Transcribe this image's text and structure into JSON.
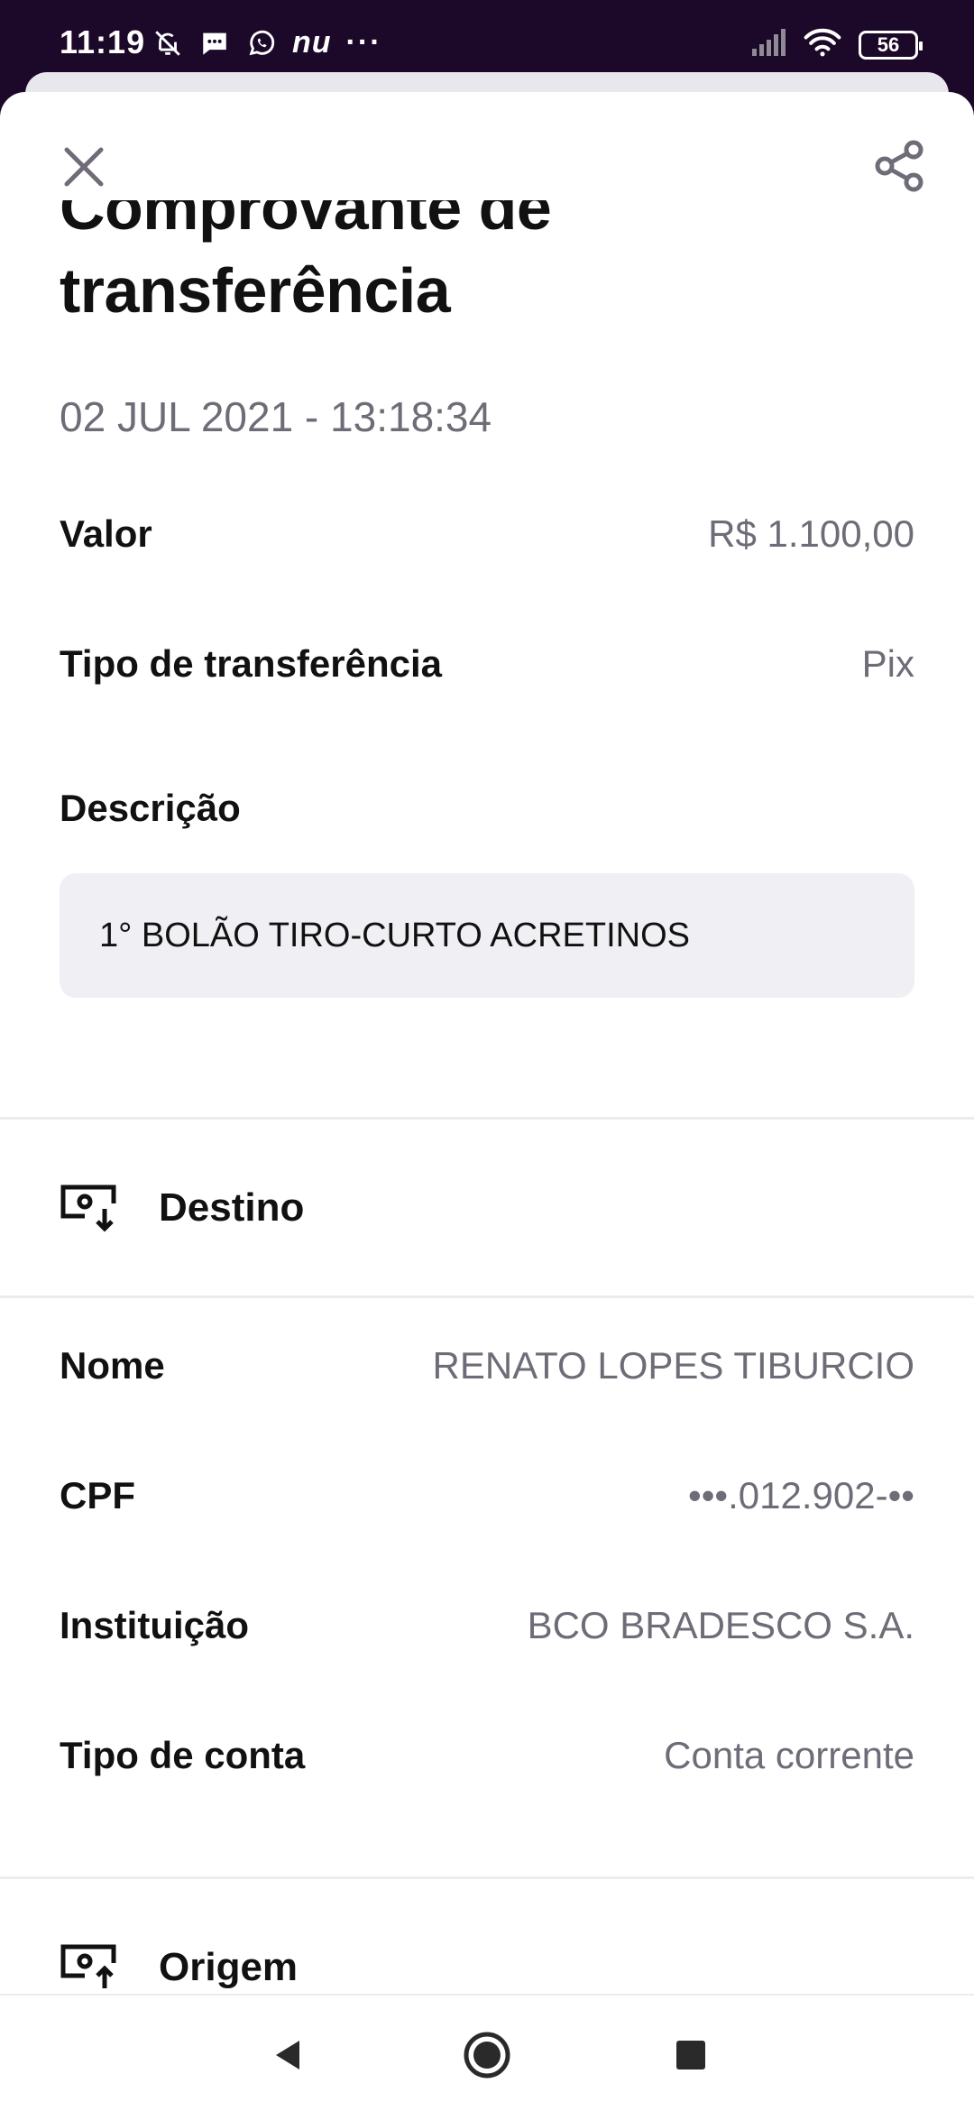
{
  "status_bar": {
    "time": "11:19",
    "nu_label": "nu",
    "more_dots": "···",
    "battery_level": "56",
    "icons_left": [
      "mute-bell-icon",
      "message-icon",
      "whatsapp-icon"
    ],
    "icons_right": [
      "signal-icon",
      "wifi-icon",
      "battery-icon"
    ]
  },
  "header": {
    "title": "Comprovante de transferência",
    "datetime": "02 JUL 2021 - 13:18:34"
  },
  "summary": {
    "valor_label": "Valor",
    "valor_value": "R$ 1.100,00",
    "tipo_label": "Tipo de transferência",
    "tipo_value": "Pix",
    "descricao_label": "Descrição",
    "descricao_value": "1° BOLÃO TIRO-CURTO ACRETINOS"
  },
  "destino": {
    "section_label": "Destino",
    "nome_label": "Nome",
    "nome_value": "RENATO LOPES TIBURCIO",
    "cpf_label": "CPF",
    "cpf_value": "•••.012.902-••",
    "instituicao_label": "Instituição",
    "instituicao_value": "BCO BRADESCO S.A.",
    "tipo_conta_label": "Tipo de conta",
    "tipo_conta_value": "Conta corrente"
  },
  "origem": {
    "section_label": "Origem"
  },
  "colors": {
    "status_bar_bg": "#1c0828",
    "text_primary": "#111111",
    "text_secondary": "#6f6c77",
    "desc_box_bg": "#f0f0f4"
  }
}
